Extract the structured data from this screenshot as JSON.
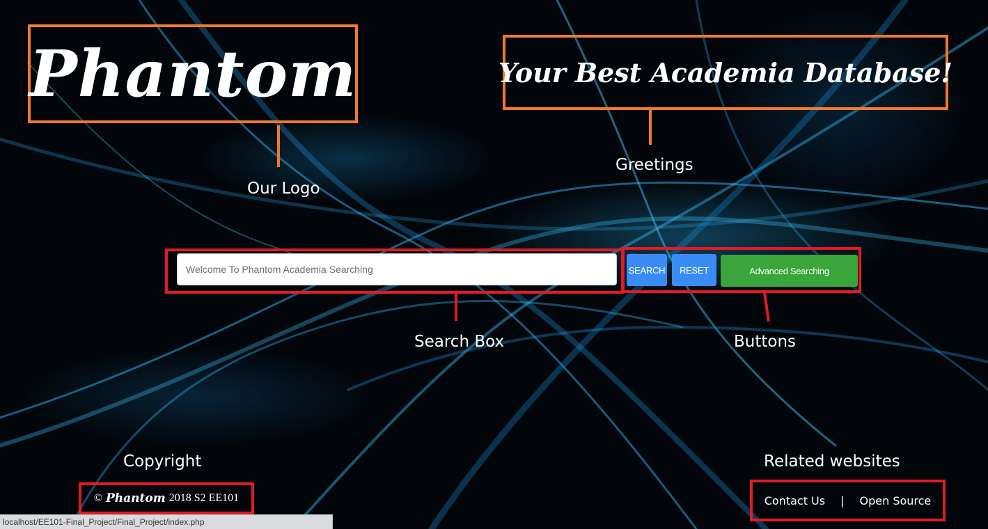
{
  "logo": {
    "text": "Phantom"
  },
  "greeting": {
    "text": "Your Best Academia Database!"
  },
  "annotations": {
    "logo_label": "Our Logo",
    "greeting_label": "Greetings",
    "search_label": "Search Box",
    "buttons_label": "Buttons",
    "copyright_label": "Copyright",
    "related_label": "Related websites"
  },
  "search": {
    "placeholder": "Welcome To Phantom Academia Searching",
    "value": ""
  },
  "buttons": {
    "search": "SEARCH",
    "reset": "RESET",
    "advanced": "Advanced Searching"
  },
  "footer": {
    "copyright_symbol": "©",
    "copyright_brand": "Phantom",
    "copyright_rest": "2018 S2 EE101",
    "contact": "Contact Us",
    "separator": "|",
    "open_source": "Open Source"
  },
  "status_bar": {
    "url": "localhost/EE101-Final_Project/Final_Project/index.php"
  },
  "colors": {
    "annotation_orange": "#f07a2a",
    "annotation_red": "#e01b24",
    "search_button": "#3a8cf5",
    "advanced_button": "#3aa53a",
    "background": "#02060b"
  }
}
